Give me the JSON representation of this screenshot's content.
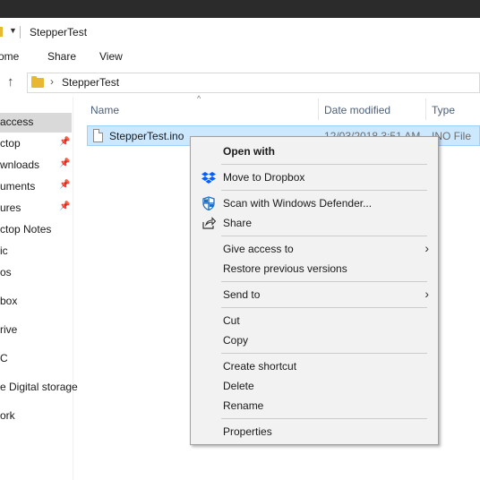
{
  "window": {
    "title": "StepperTest"
  },
  "ribbon": {
    "tabs": [
      "Home",
      "Share",
      "View"
    ],
    "tab_visible_text": [
      "ome",
      "Share",
      "View"
    ]
  },
  "address": {
    "path": "StepperTest"
  },
  "nav_pane": {
    "items": [
      {
        "label": "access",
        "pinned": false,
        "selected": true
      },
      {
        "label": "ctop",
        "pinned": true
      },
      {
        "label": "wnloads",
        "pinned": true
      },
      {
        "label": "uments",
        "pinned": true
      },
      {
        "label": "ures",
        "pinned": true
      },
      {
        "label": "ctop Notes",
        "pinned": false
      },
      {
        "label": "ic",
        "pinned": false
      },
      {
        "label": "os",
        "pinned": false
      },
      {
        "label": "box",
        "pinned": false
      },
      {
        "label": "rive",
        "pinned": false
      },
      {
        "label": "C",
        "pinned": false
      },
      {
        "label": "e Digital storage",
        "pinned": false
      },
      {
        "label": "ork",
        "pinned": false
      }
    ]
  },
  "columns": {
    "name": "Name",
    "date": "Date modified",
    "type": "Type"
  },
  "file": {
    "name": "StepperTest.ino",
    "date": "12/03/2018 3:51 AM",
    "type": "INO File"
  },
  "context_menu": {
    "open_with": "Open with",
    "move_dropbox": "Move to Dropbox",
    "scan_defender": "Scan with Windows Defender...",
    "share": "Share",
    "give_access": "Give access to",
    "restore": "Restore previous versions",
    "send_to": "Send to",
    "cut": "Cut",
    "copy": "Copy",
    "create_shortcut": "Create shortcut",
    "delete": "Delete",
    "rename": "Rename",
    "properties": "Properties"
  },
  "colors": {
    "selection": "#cce8ff",
    "dropbox": "#0061fe",
    "defender": "#1e6fc6",
    "folder": "#e8b833"
  }
}
